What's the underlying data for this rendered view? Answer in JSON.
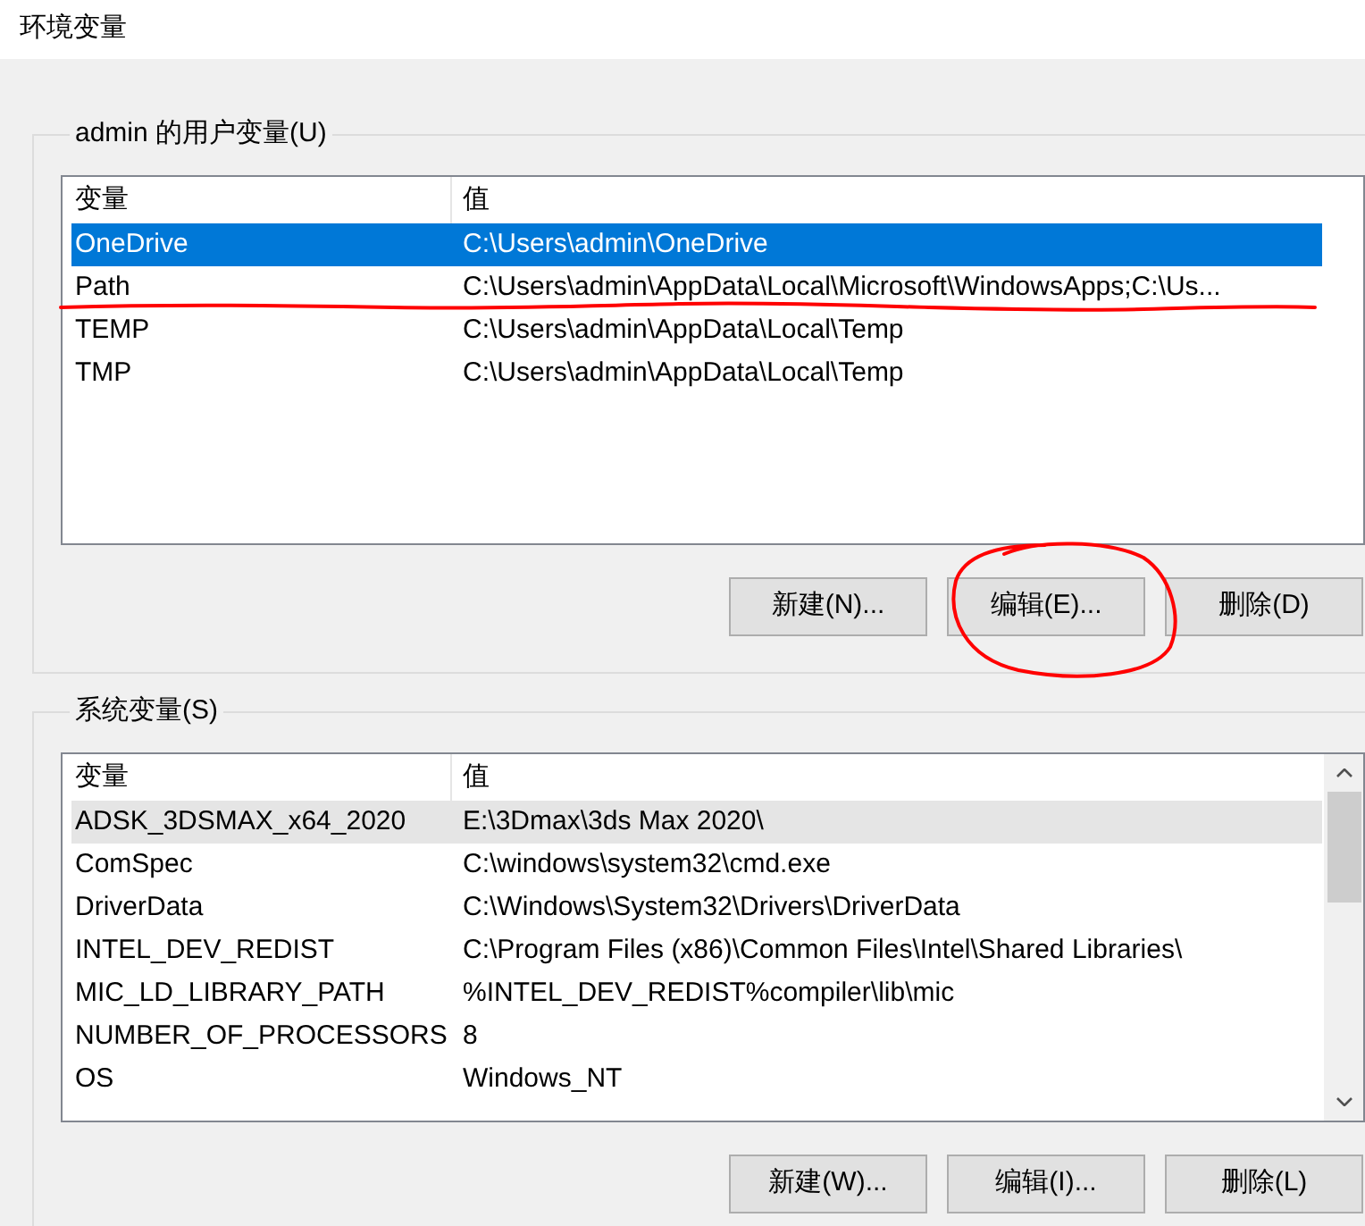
{
  "window": {
    "title": "环境变量"
  },
  "user_variables": {
    "label": "admin 的用户变量(U)",
    "focused": true,
    "columns": [
      "变量",
      "值"
    ],
    "rows": [
      {
        "name": "OneDrive",
        "value": "C:\\Users\\admin\\OneDrive",
        "selected": true,
        "underlined": false
      },
      {
        "name": "Path",
        "value": "C:\\Users\\admin\\AppData\\Local\\Microsoft\\WindowsApps;C:\\Us...",
        "selected": false,
        "underlined": true
      },
      {
        "name": "TEMP",
        "value": "C:\\Users\\admin\\AppData\\Local\\Temp",
        "selected": false,
        "underlined": false
      },
      {
        "name": "TMP",
        "value": "C:\\Users\\admin\\AppData\\Local\\Temp",
        "selected": false,
        "underlined": false
      }
    ],
    "buttons": [
      {
        "label": "新建(N)...",
        "circled": false
      },
      {
        "label": "编辑(E)...",
        "circled": true
      },
      {
        "label": "删除(D)",
        "circled": false
      }
    ]
  },
  "system_variables": {
    "label": "系统变量(S)",
    "focused": false,
    "scrollbar": true,
    "columns": [
      "变量",
      "值"
    ],
    "rows": [
      {
        "name": "ADSK_3DSMAX_x64_2020",
        "value": "E:\\3Dmax\\3ds Max 2020\\",
        "selected": true
      },
      {
        "name": "ComSpec",
        "value": "C:\\windows\\system32\\cmd.exe",
        "selected": false
      },
      {
        "name": "DriverData",
        "value": "C:\\Windows\\System32\\Drivers\\DriverData",
        "selected": false
      },
      {
        "name": "INTEL_DEV_REDIST",
        "value": "C:\\Program Files (x86)\\Common Files\\Intel\\Shared Libraries\\",
        "selected": false
      },
      {
        "name": "MIC_LD_LIBRARY_PATH",
        "value": "%INTEL_DEV_REDIST%compiler\\lib\\mic",
        "selected": false
      },
      {
        "name": "NUMBER_OF_PROCESSORS",
        "value": "8",
        "selected": false
      },
      {
        "name": "OS",
        "value": "Windows_NT",
        "selected": false
      }
    ],
    "buttons": [
      {
        "label": "新建(W)...",
        "circled": false
      },
      {
        "label": "编辑(I)...",
        "circled": false
      },
      {
        "label": "删除(L)",
        "circled": false
      }
    ]
  }
}
